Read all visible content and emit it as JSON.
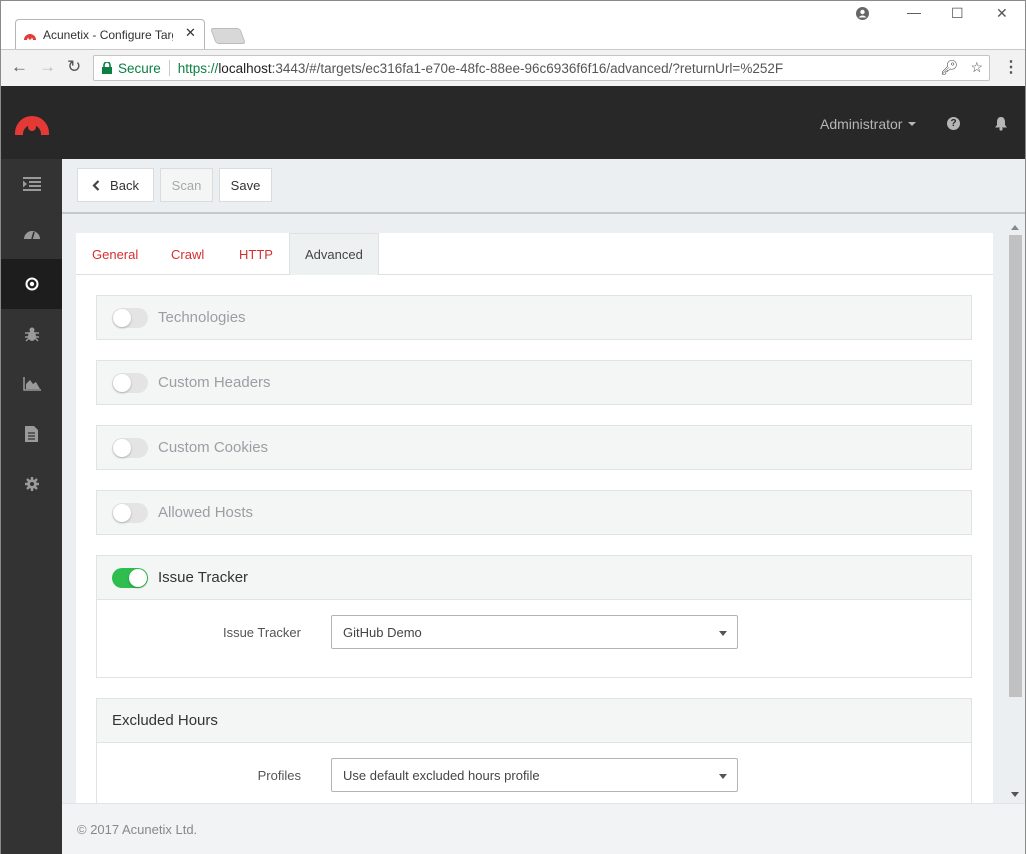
{
  "browser": {
    "tab_title": "Acunetix - Configure Targ",
    "secure_label": "Secure",
    "url_scheme": "https://",
    "url_host": "localhost",
    "url_rest": ":3443/#/targets/ec316fa1-e70e-48fc-88ee-96c6936f6f16/advanced/?returnUrl=%252F",
    "accent_secure": "#0b8043"
  },
  "header": {
    "user_label": "Administrator",
    "brand_color": "#e53935"
  },
  "sidebar": {
    "items": [
      {
        "name": "menu-toggle",
        "icon": "indent-icon",
        "active": false
      },
      {
        "name": "dashboard",
        "icon": "dashboard-gauge-icon",
        "active": false
      },
      {
        "name": "targets",
        "icon": "target-icon",
        "active": true
      },
      {
        "name": "vulnerabilities",
        "icon": "bug-icon",
        "active": false
      },
      {
        "name": "scans",
        "icon": "area-chart-icon",
        "active": false
      },
      {
        "name": "reports",
        "icon": "file-text-icon",
        "active": false
      },
      {
        "name": "settings",
        "icon": "gear-icon",
        "active": false
      }
    ]
  },
  "toolbar": {
    "back_label": "Back",
    "scan_label": "Scan",
    "save_label": "Save"
  },
  "tabs": [
    {
      "label": "General",
      "active": false
    },
    {
      "label": "Crawl",
      "active": false
    },
    {
      "label": "HTTP",
      "active": false
    },
    {
      "label": "Advanced",
      "active": true
    }
  ],
  "panels": {
    "technologies": {
      "label": "Technologies",
      "enabled": false
    },
    "custom_headers": {
      "label": "Custom Headers",
      "enabled": false
    },
    "custom_cookies": {
      "label": "Custom Cookies",
      "enabled": false
    },
    "allowed_hosts": {
      "label": "Allowed Hosts",
      "enabled": false
    },
    "issue_tracker": {
      "label": "Issue Tracker",
      "enabled": true,
      "field_label": "Issue Tracker",
      "field_value": "GitHub Demo"
    },
    "excluded_hours": {
      "label": "Excluded Hours",
      "field_label": "Profiles",
      "field_value": "Use default excluded hours profile"
    }
  },
  "footer": {
    "copyright": "© 2017 Acunetix Ltd."
  }
}
